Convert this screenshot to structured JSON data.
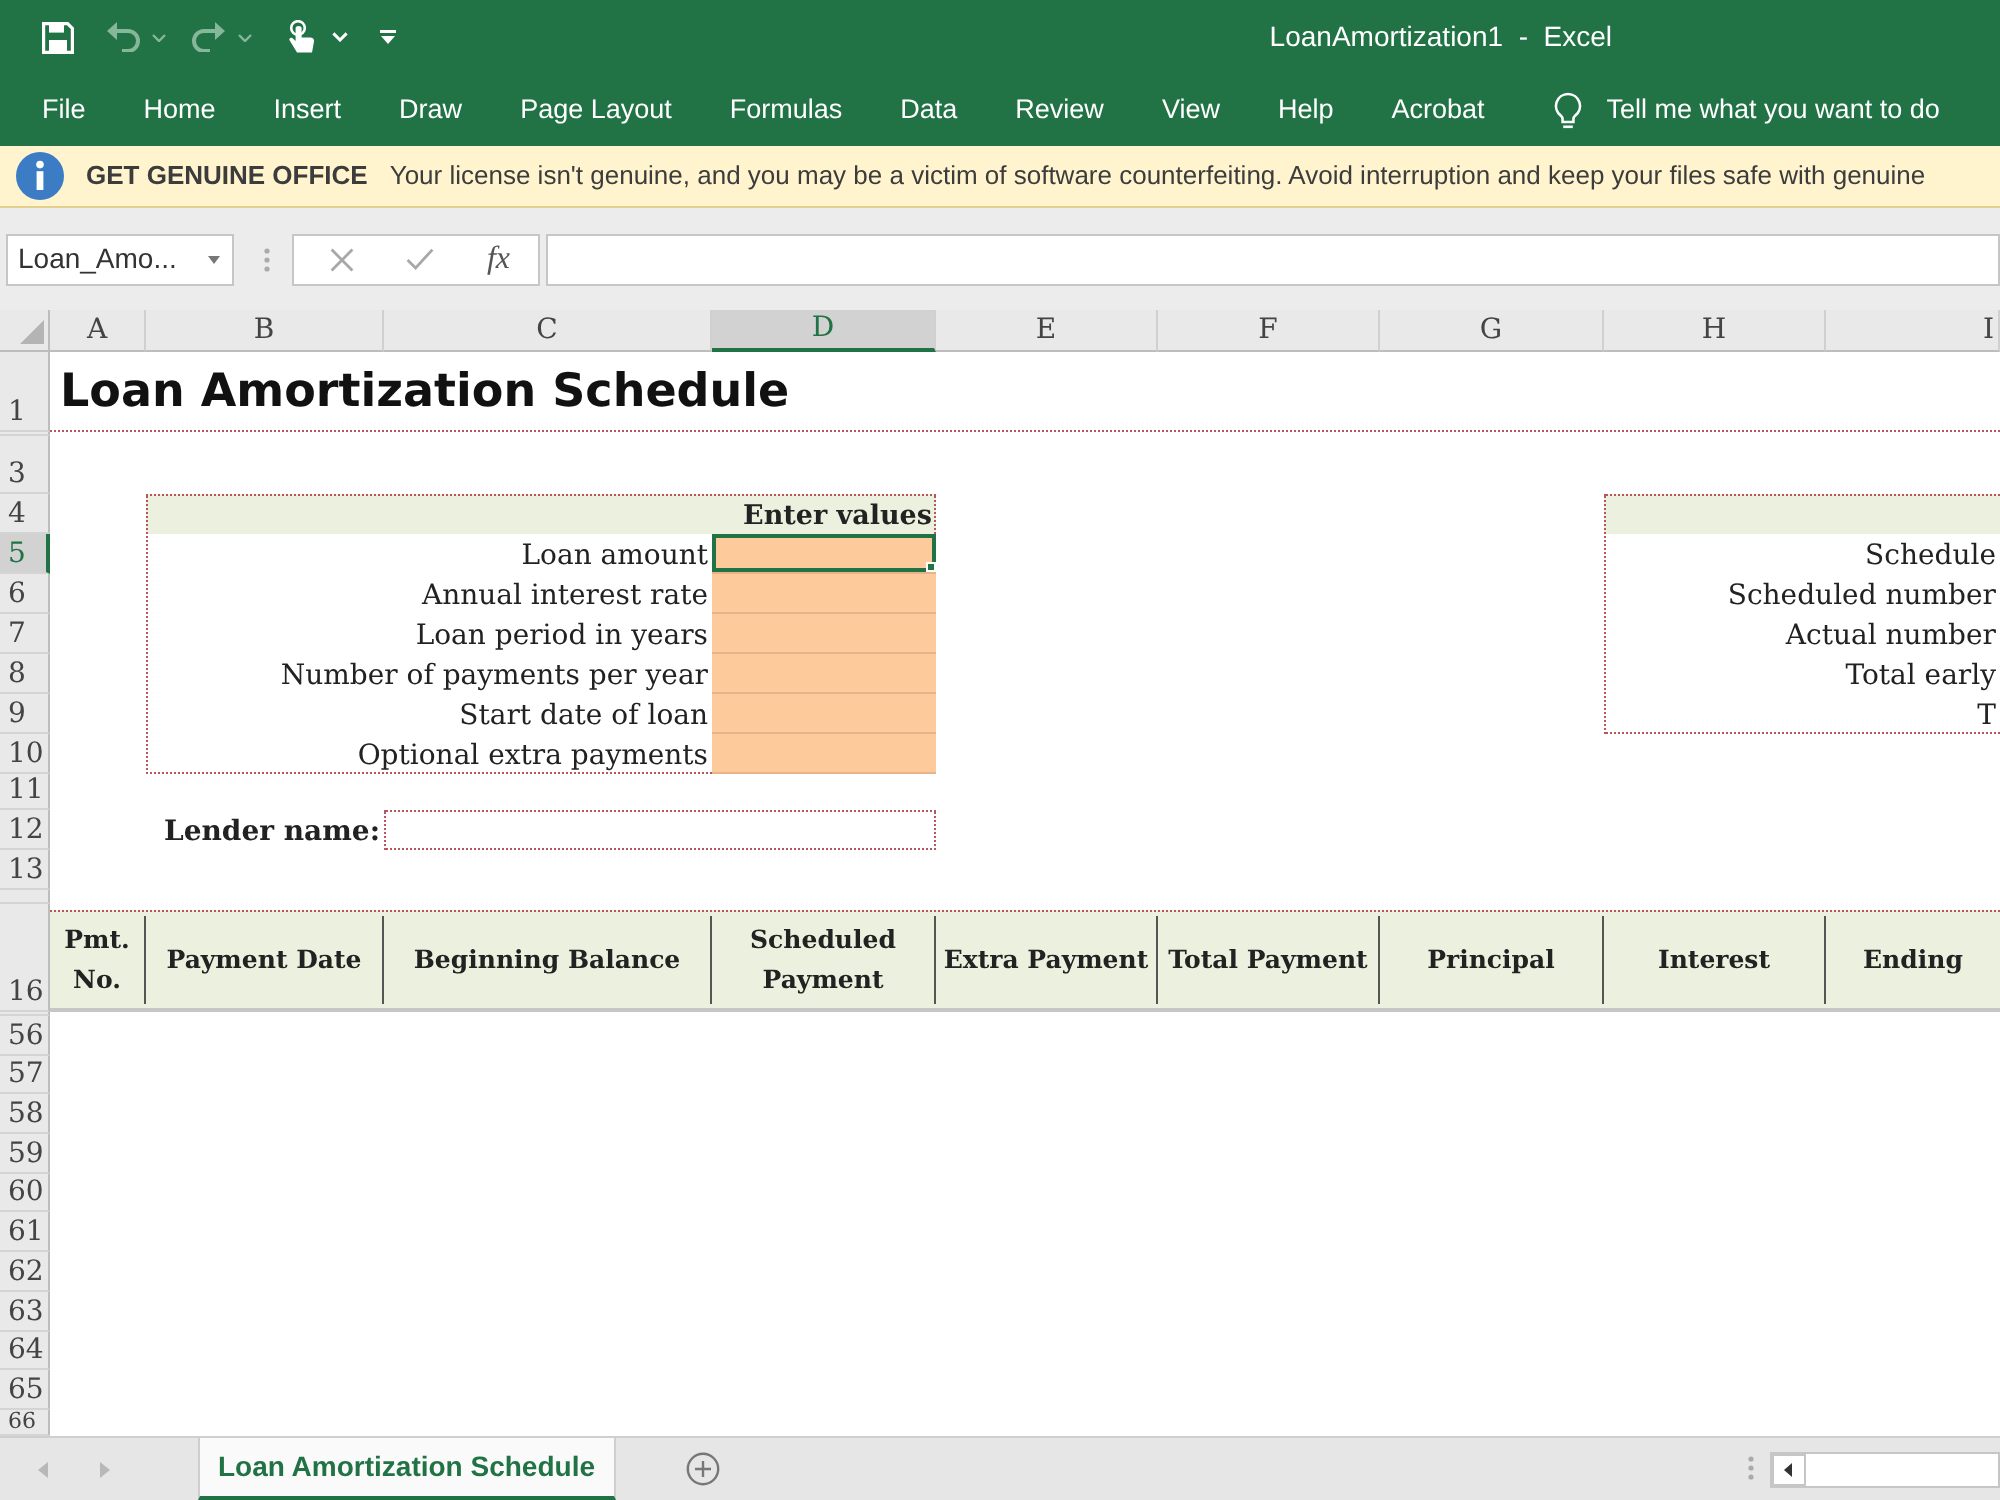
{
  "window": {
    "title": "LoanAmortization1  -  Excel"
  },
  "ribbon": {
    "tabs": [
      "File",
      "Home",
      "Insert",
      "Draw",
      "Page Layout",
      "Formulas",
      "Data",
      "Review",
      "View",
      "Help",
      "Acrobat"
    ],
    "tell_me": "Tell me what you want to do"
  },
  "message_bar": {
    "title": "GET GENUINE OFFICE",
    "text": "Your license isn't genuine, and you may be a victim of software counterfeiting. Avoid interruption and keep your files safe with genuine"
  },
  "formula_bar": {
    "name_box": "Loan_Amo...",
    "function_label": "fx"
  },
  "column_headers": [
    {
      "label": "A",
      "selected": false
    },
    {
      "label": "B",
      "selected": false
    },
    {
      "label": "C",
      "selected": false
    },
    {
      "label": "D",
      "selected": true
    },
    {
      "label": "E",
      "selected": false
    },
    {
      "label": "F",
      "selected": false
    },
    {
      "label": "G",
      "selected": false
    },
    {
      "label": "H",
      "selected": false
    },
    {
      "label": "I",
      "selected": false
    }
  ],
  "row_headers": [
    {
      "label": "1",
      "selected": false
    },
    {
      "label": "3",
      "selected": false
    },
    {
      "label": "4",
      "selected": false
    },
    {
      "label": "5",
      "selected": true
    },
    {
      "label": "6",
      "selected": false
    },
    {
      "label": "7",
      "selected": false
    },
    {
      "label": "8",
      "selected": false
    },
    {
      "label": "9",
      "selected": false
    },
    {
      "label": "10",
      "selected": false
    },
    {
      "label": "11",
      "selected": false
    },
    {
      "label": "12",
      "selected": false
    },
    {
      "label": "13",
      "selected": false
    },
    {
      "label": "16",
      "selected": false
    },
    {
      "label": "56",
      "selected": false
    },
    {
      "label": "57",
      "selected": false
    },
    {
      "label": "58",
      "selected": false
    },
    {
      "label": "59",
      "selected": false
    },
    {
      "label": "60",
      "selected": false
    },
    {
      "label": "61",
      "selected": false
    },
    {
      "label": "62",
      "selected": false
    },
    {
      "label": "63",
      "selected": false
    },
    {
      "label": "64",
      "selected": false
    },
    {
      "label": "65",
      "selected": false
    },
    {
      "label": "66",
      "selected": false
    }
  ],
  "sheet": {
    "title": "Loan Amortization Schedule",
    "input_table": {
      "header": "Enter values",
      "rows": [
        {
          "label": "Loan amount",
          "selected": true
        },
        {
          "label": "Annual interest rate",
          "selected": false
        },
        {
          "label": "Loan period in years",
          "selected": false
        },
        {
          "label": "Number of payments per year",
          "selected": false
        },
        {
          "label": "Start date of loan",
          "selected": false
        },
        {
          "label": "Optional extra payments",
          "selected": false
        }
      ]
    },
    "lender": {
      "label": "Lender name:"
    },
    "summary_table": {
      "rows": [
        "Schedule",
        "Scheduled number",
        "Actual number",
        "Total early",
        "T"
      ]
    },
    "schedule_columns": [
      "Pmt. No.",
      "Payment Date",
      "Beginning Balance",
      "Scheduled Payment",
      "Extra Payment",
      "Total Payment",
      "Principal",
      "Interest",
      "Ending"
    ]
  },
  "sheet_tabs": [
    {
      "label": "Loan Amortization Schedule",
      "selected": true
    }
  ]
}
